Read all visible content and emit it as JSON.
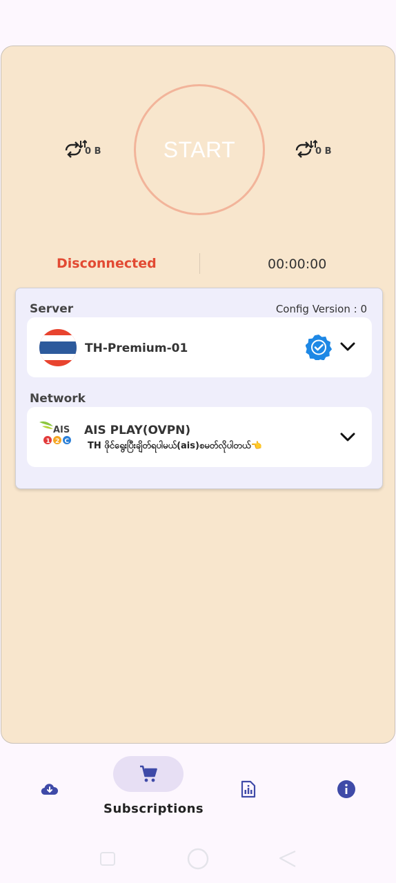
{
  "connection": {
    "upload_traffic": "0 B",
    "download_traffic": "0 B",
    "start_label": "START",
    "status": "Disconnected",
    "timer": "00:00:00"
  },
  "server": {
    "section_label": "Server",
    "config_version": "Config Version : 0",
    "name": "TH-Premium-01"
  },
  "network": {
    "section_label": "Network",
    "name": "AIS PLAY(OVPN)",
    "description": "TH ဖိုင်ရွေးပြီးချိတ်ရပါမယ်(ais)စမတ်လိုပါတယ်👈"
  },
  "bottom_nav": {
    "items": [
      {
        "icon": "cloud-download-icon"
      },
      {
        "icon": "shopping-cart-icon",
        "label": "Subscriptions",
        "selected": true
      },
      {
        "icon": "sim-card-icon"
      },
      {
        "icon": "info-icon"
      }
    ]
  },
  "colors": {
    "card_background": "#f8e6cd",
    "status_disconnected": "#e24a33",
    "start_ring": "#f2b49a",
    "nav_icon": "#3f4aa8",
    "verified_badge": "#1e88e5"
  }
}
